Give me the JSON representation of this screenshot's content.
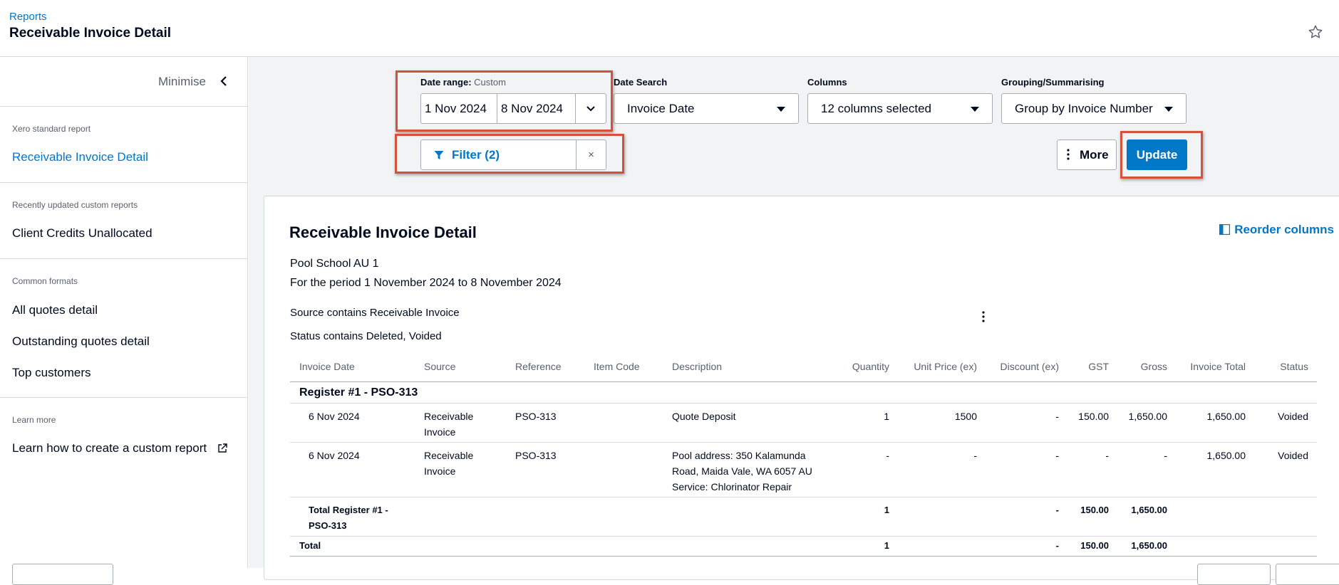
{
  "header": {
    "breadcrumb": "Reports",
    "title": "Receivable Invoice Detail"
  },
  "sidebar": {
    "minimise_label": "Minimise",
    "sections": [
      {
        "heading": "Xero standard report",
        "items": [
          "Receivable Invoice Detail"
        ]
      },
      {
        "heading": "Recently updated custom reports",
        "items": [
          "Client Credits Unallocated"
        ]
      },
      {
        "heading": "Common formats",
        "items": [
          "All quotes detail",
          "Outstanding quotes detail",
          "Top customers"
        ]
      },
      {
        "heading": "Learn more",
        "items": [
          "Learn how to create a custom report"
        ]
      }
    ]
  },
  "controls": {
    "date_range": {
      "label": "Date range:",
      "mode": "Custom",
      "from": "1 Nov 2024",
      "to": "8 Nov 2024"
    },
    "date_search": {
      "label": "Date Search",
      "value": "Invoice Date"
    },
    "columns": {
      "label": "Columns",
      "value": "12 columns selected"
    },
    "grouping": {
      "label": "Grouping/Summarising",
      "value": "Group by Invoice Number"
    },
    "filter": {
      "label": "Filter (2)",
      "clear": "×"
    },
    "more_label": "More",
    "update_label": "Update"
  },
  "report": {
    "title": "Receivable Invoice Detail",
    "reorder_label": "Reorder columns",
    "org": "Pool School AU 1",
    "period": "For the period 1 November 2024 to 8 November 2024",
    "filters": [
      "Source contains Receivable Invoice",
      "Status contains Deleted, Voided"
    ],
    "columns": [
      "Invoice Date",
      "Source",
      "Reference",
      "Item Code",
      "Description",
      "Quantity",
      "Unit Price (ex)",
      "Discount (ex)",
      "GST",
      "Gross",
      "Invoice Total",
      "Status"
    ],
    "group_title": "Register #1 - PSO-313",
    "rows": [
      {
        "date": "6 Nov 2024",
        "source_l1": "Receivable",
        "source_l2": "Invoice",
        "reference": "PSO-313",
        "item_code": "",
        "desc_l1": "Quote Deposit",
        "desc_l2": "",
        "desc_l3": "",
        "quantity": "1",
        "unit_price": "1500",
        "discount": "-",
        "gst": "150.00",
        "gross": "1,650.00",
        "invoice_total": "1,650.00",
        "status": "Voided"
      },
      {
        "date": "6 Nov 2024",
        "source_l1": "Receivable",
        "source_l2": "Invoice",
        "reference": "PSO-313",
        "item_code": "",
        "desc_l1": "Pool address: 350 Kalamunda",
        "desc_l2": "Road, Maida Vale, WA 6057 AU",
        "desc_l3": "Service: Chlorinator Repair",
        "quantity": "-",
        "unit_price": "-",
        "discount": "-",
        "gst": "-",
        "gross": "-",
        "invoice_total": "1,650.00",
        "status": "Voided"
      }
    ],
    "subtotal": {
      "label_l1": "Total Register #1 -",
      "label_l2": "PSO-313",
      "quantity": "1",
      "discount": "-",
      "gst": "150.00",
      "gross": "1,650.00"
    },
    "total": {
      "label": "Total",
      "quantity": "1",
      "discount": "-",
      "gst": "150.00",
      "gross": "1,650.00"
    }
  }
}
